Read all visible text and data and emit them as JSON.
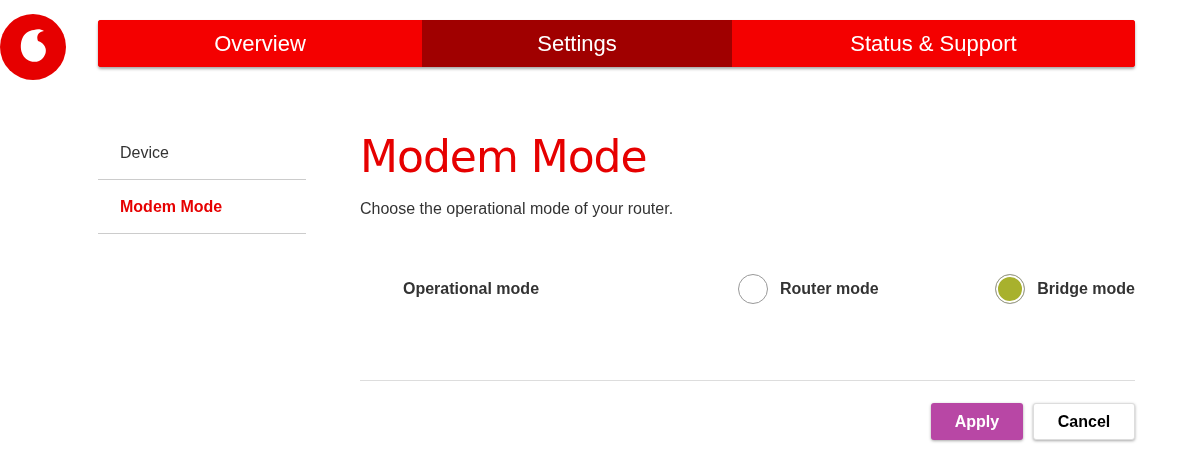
{
  "nav": {
    "tabs": [
      {
        "label": "Overview",
        "selected": false
      },
      {
        "label": "Settings",
        "selected": true
      },
      {
        "label": "Status & Support",
        "selected": false
      }
    ]
  },
  "sidebar": {
    "items": [
      {
        "label": "Device",
        "selected": false
      },
      {
        "label": "Modem Mode",
        "selected": true
      }
    ]
  },
  "page": {
    "title": "Modem Mode",
    "description": "Choose the operational mode of your router."
  },
  "form": {
    "label": "Operational mode",
    "options": [
      {
        "label": "Router mode",
        "selected": false
      },
      {
        "label": "Bridge mode",
        "selected": true
      }
    ]
  },
  "buttons": [
    {
      "label": "Apply",
      "kind": "primary"
    },
    {
      "label": "Cancel",
      "kind": "secondary"
    }
  ]
}
